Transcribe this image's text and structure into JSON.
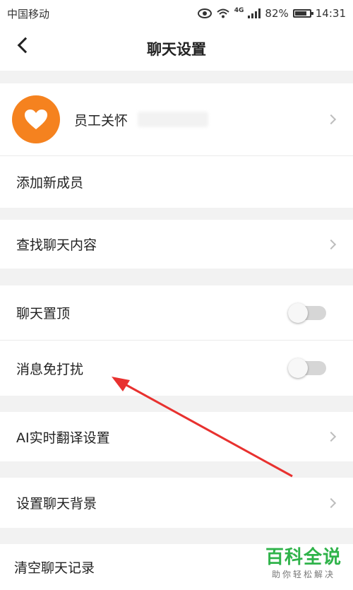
{
  "status_bar": {
    "carrier": "中国移动",
    "network": "4G",
    "battery": "82%",
    "battery_level": 0.82,
    "time": "14:31"
  },
  "header": {
    "title": "聊天设置"
  },
  "contact": {
    "name": "员工关怀"
  },
  "rows": {
    "add_member": "添加新成员",
    "search_content": "查找聊天内容",
    "pin_chat": "聊天置顶",
    "do_not_disturb": "消息免打扰",
    "ai_translate": "AI实时翻译设置",
    "set_background": "设置聊天背景",
    "clear_history": "清空聊天记录"
  },
  "toggles": {
    "pin_chat_on": false,
    "do_not_disturb_on": false
  },
  "colors": {
    "avatar": "#f5821f",
    "annotation_arrow": "#e8312f",
    "watermark": "#2fb34a"
  },
  "watermark": {
    "main": "百科全说",
    "sub": "助你轻松解决"
  }
}
